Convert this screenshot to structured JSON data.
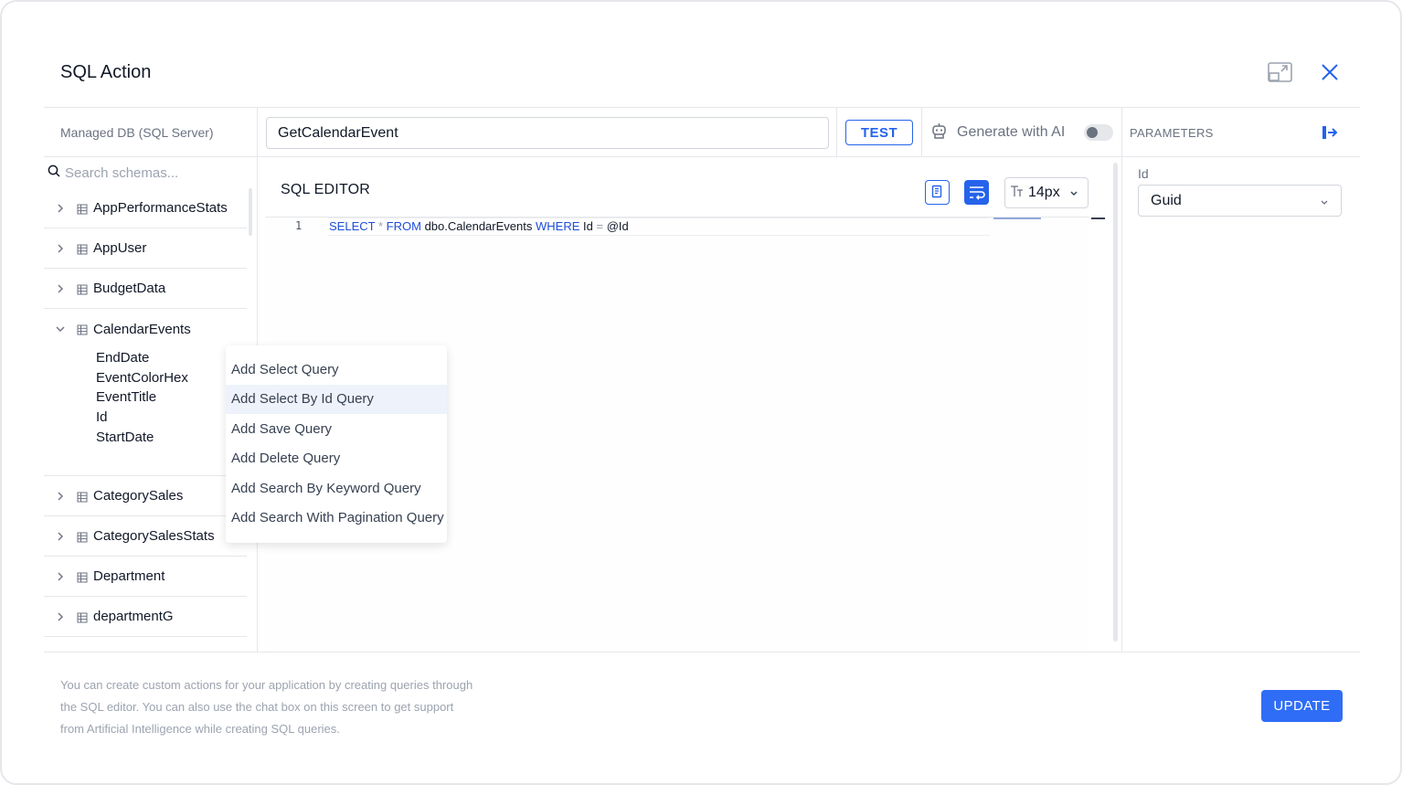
{
  "dialog": {
    "title": "SQL Action"
  },
  "header": {
    "expand_icon": "expand-icon",
    "close_icon": "close-icon"
  },
  "toolbar": {
    "db_name": "Managed DB (SQL Server)",
    "action_name_value": "GetCalendarEvent",
    "test_label": "TEST",
    "ai_label": "Generate with AI",
    "ai_toggle_on": false
  },
  "schema": {
    "search_placeholder": "Search schemas...",
    "tables": [
      {
        "name": "AppPerformanceStats",
        "expanded": false
      },
      {
        "name": "AppUser",
        "expanded": false
      },
      {
        "name": "BudgetData",
        "expanded": false
      },
      {
        "name": "CalendarEvents",
        "expanded": true,
        "columns": [
          "EndDate",
          "EventColorHex",
          "EventTitle",
          "Id",
          "StartDate"
        ]
      },
      {
        "name": "CategorySales",
        "expanded": false
      },
      {
        "name": "CategorySalesStats",
        "expanded": false
      },
      {
        "name": "Department",
        "expanded": false
      },
      {
        "name": "departmentG",
        "expanded": false
      }
    ]
  },
  "editor": {
    "title": "SQL EDITOR",
    "font_size": "14px",
    "line_number": "1",
    "code": {
      "k1": "SELECT",
      "op1": "*",
      "k2": "FROM",
      "t1": "dbo.CalendarEvents",
      "k3": "WHERE",
      "t2": "Id",
      "op2": "=",
      "t3": "@Id"
    }
  },
  "context_menu": {
    "items": [
      "Add Select Query",
      "Add Select By Id Query",
      "Add Save Query",
      "Add Delete Query",
      "Add Search By Keyword Query",
      "Add Search With Pagination Query"
    ],
    "highlighted": "Add Select By Id Query"
  },
  "parameters": {
    "title": "PARAMETERS",
    "items": [
      {
        "label": "Id",
        "type": "Guid"
      }
    ]
  },
  "footer": {
    "line1": "You can create custom actions for your application by creating queries through",
    "line2": "the SQL editor. You can also use the chat box on this screen to get support",
    "line3": "from Artificial Intelligence while creating SQL queries.",
    "update_label": "UPDATE"
  },
  "colors": {
    "accent": "#2563eb",
    "update_button": "#2f6df6",
    "menu_highlight": "#eef2fb"
  }
}
